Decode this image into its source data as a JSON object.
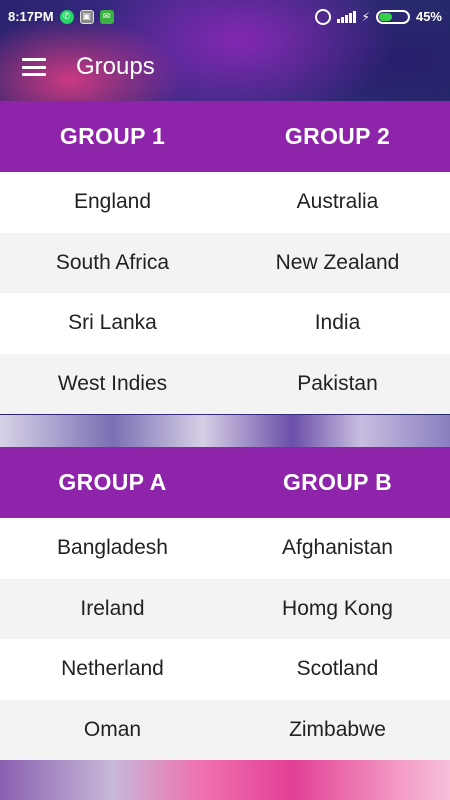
{
  "status_bar": {
    "time": "8:17PM",
    "battery_percent": "45%",
    "battery_level": 0.45
  },
  "app_bar": {
    "title": "Groups"
  },
  "groups": [
    {
      "left_header": "GROUP 1",
      "right_header": "GROUP 2",
      "rows": [
        {
          "left": "England",
          "right": "Australia"
        },
        {
          "left": "South Africa",
          "right": "New Zealand"
        },
        {
          "left": "Sri Lanka",
          "right": "India"
        },
        {
          "left": "West Indies",
          "right": "Pakistan"
        }
      ]
    },
    {
      "left_header": "GROUP A",
      "right_header": "GROUP B",
      "rows": [
        {
          "left": "Bangladesh",
          "right": "Afghanistan"
        },
        {
          "left": "Ireland",
          "right": "Homg Kong"
        },
        {
          "left": "Netherland",
          "right": "Scotland"
        },
        {
          "left": "Oman",
          "right": "Zimbabwe"
        }
      ]
    }
  ],
  "colors": {
    "header_purple": "#8e24aa",
    "row_alt": "#f3f3f3"
  }
}
